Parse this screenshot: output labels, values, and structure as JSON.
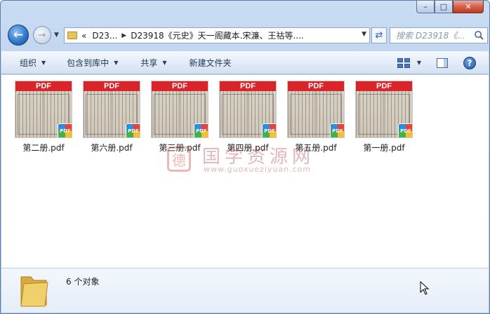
{
  "window": {
    "minimize": "–",
    "maximize": "□",
    "close": "✕"
  },
  "nav": {
    "back": "←",
    "forward": "→",
    "crumb_prefix": "«",
    "crumb_1": "D23...",
    "crumb_2": "D23918《元史》天一阁藏本.宋濂、王祜等....",
    "refresh": "⇄",
    "search_placeholder": "搜索 D23918《..."
  },
  "toolbar": {
    "organize": "组织",
    "include_in_library": "包含到库中",
    "share": "共享",
    "new_folder": "新建文件夹",
    "help": "?"
  },
  "files": [
    {
      "name": "第二册.pdf",
      "band": "PDF",
      "badge": "PDF"
    },
    {
      "name": "第六册.pdf",
      "band": "PDF",
      "badge": "PDF"
    },
    {
      "name": "第三册.pdf",
      "band": "PDF",
      "badge": "PDF"
    },
    {
      "name": "第四册.pdf",
      "band": "PDF",
      "badge": "PDF"
    },
    {
      "name": "第五册.pdf",
      "band": "PDF",
      "badge": "PDF"
    },
    {
      "name": "第一册.pdf",
      "band": "PDF",
      "badge": "PDF"
    }
  ],
  "watermark": {
    "seal": "德",
    "title": "国学资源网",
    "url": "www.guoxueziyuan.com"
  },
  "status": {
    "object_count": "6 个对象"
  },
  "colors": {
    "pdf_band": "#d9242a",
    "toolbar_text": "#1f3454"
  }
}
